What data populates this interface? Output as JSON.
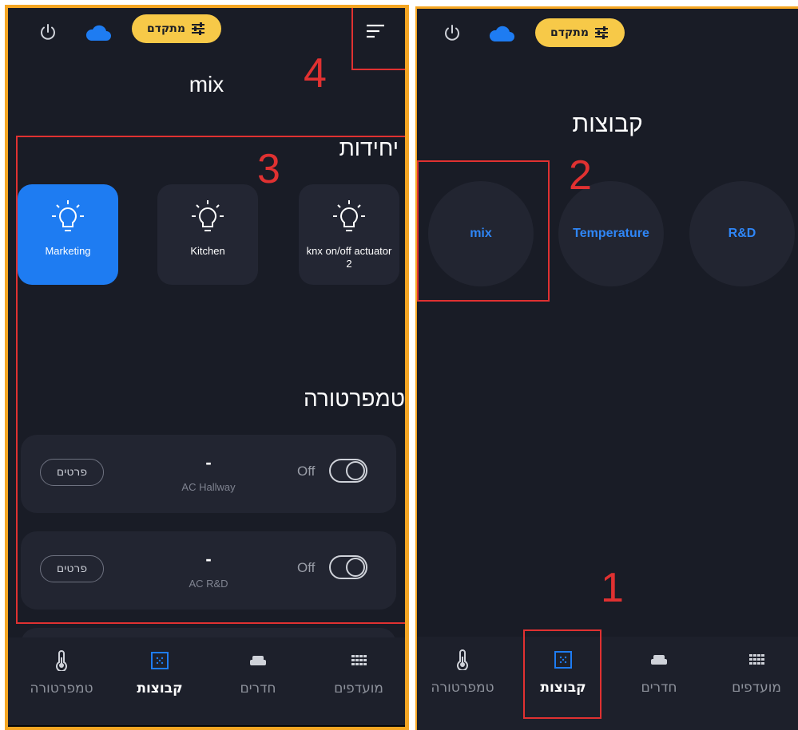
{
  "colors": {
    "background": "#191c26",
    "accent": "#1e7cf2",
    "pill": "#f7c948",
    "highlight_border": "#f5a623",
    "annotation": "#e03131"
  },
  "left_screen": {
    "header": {
      "power_icon": "power-icon",
      "cloud_icon": "cloud-icon",
      "advanced_label": "מתקדם",
      "menu_icon": "sort-menu-icon"
    },
    "page_title": "mix",
    "units_section": {
      "title": "יחידות",
      "tiles": [
        {
          "label": "Marketing",
          "active": true
        },
        {
          "label": "Kitchen",
          "active": false
        },
        {
          "label": "knx on/off actuator 2",
          "active": false
        }
      ]
    },
    "temperature_section": {
      "title": "טמפרטורה",
      "cards": [
        {
          "value": "-",
          "name": "AC Hallway",
          "state": "Off",
          "details_label": "פרטים"
        },
        {
          "value": "-",
          "name": "AC R&D",
          "state": "Off",
          "details_label": "פרטים"
        }
      ]
    }
  },
  "right_screen": {
    "header": {
      "advanced_label": "מתקדם"
    },
    "page_title": "קבוצות",
    "groups": [
      {
        "label": "mix"
      },
      {
        "label": "Temperature"
      },
      {
        "label": "R&D"
      }
    ]
  },
  "bottom_nav": {
    "items": [
      {
        "label": "טמפרטורה",
        "icon": "thermometer-icon",
        "active": false
      },
      {
        "label": "קבוצות",
        "icon": "groups-icon",
        "active": true
      },
      {
        "label": "חדרים",
        "icon": "sofa-icon",
        "active": false
      },
      {
        "label": "מועדפים",
        "icon": "grid-icon",
        "active": false
      }
    ]
  },
  "annotations": {
    "n1": "1",
    "n2": "2",
    "n3": "3",
    "n4": "4"
  }
}
